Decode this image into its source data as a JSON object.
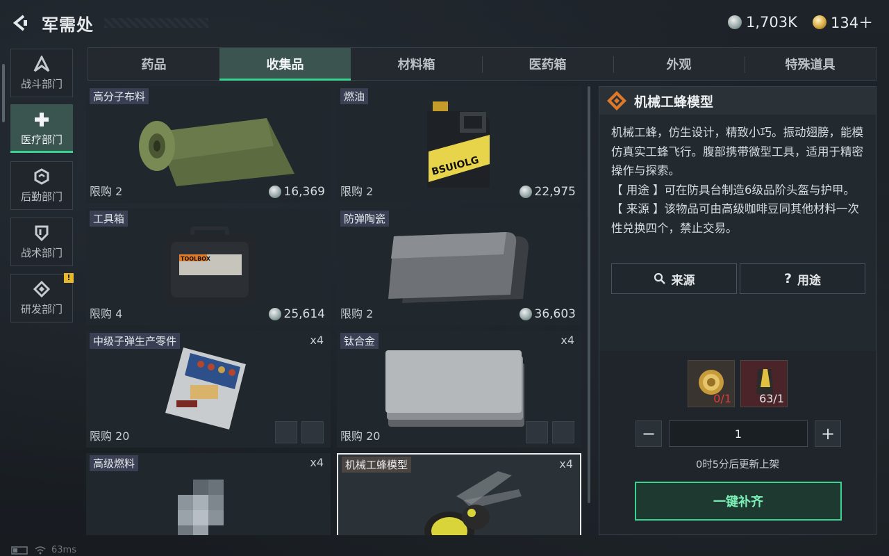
{
  "header": {
    "title": "军需处",
    "currency": [
      {
        "icon": "silver-coin-icon",
        "value": "1,703K"
      },
      {
        "icon": "gold-coin-icon",
        "value": "134＋"
      }
    ]
  },
  "sidebar": {
    "items": [
      {
        "label": "战斗部门",
        "icon": "combat-icon"
      },
      {
        "label": "医疗部门",
        "icon": "medical-cross-icon",
        "active": true
      },
      {
        "label": "后勤部门",
        "icon": "logistics-icon"
      },
      {
        "label": "战术部门",
        "icon": "tactical-shield-icon"
      },
      {
        "label": "研发部门",
        "icon": "research-icon",
        "badge": "!"
      }
    ]
  },
  "tabs": [
    "药品",
    "收集品",
    "材料箱",
    "医药箱",
    "外观",
    "特殊道具"
  ],
  "active_tab": "收集品",
  "items": [
    {
      "name": "高分子布料",
      "limit": "限购 2",
      "price": "16,369",
      "qty": ""
    },
    {
      "name": "燃油",
      "limit": "限购 2",
      "price": "22,975",
      "qty": "",
      "label_art": "BSUIOLG"
    },
    {
      "name": "工具箱",
      "limit": "限购 4",
      "price": "25,614",
      "qty": "",
      "label_art": "TOOLBOX"
    },
    {
      "name": "防弹陶瓷",
      "limit": "限购 2",
      "price": "36,603",
      "qty": ""
    },
    {
      "name": "中级子弹生产零件",
      "limit": "限购 20",
      "price": "",
      "qty": "x4"
    },
    {
      "name": "钛合金",
      "limit": "限购 20",
      "price": "",
      "qty": "x4"
    },
    {
      "name": "高级燃料",
      "limit": "",
      "price": "",
      "qty": "x4"
    },
    {
      "name": "机械工蜂模型",
      "limit": "",
      "price": "",
      "qty": "x4",
      "selected": true
    }
  ],
  "detail": {
    "title": "机械工蜂模型",
    "description": "机械工蜂，仿生设计，精致小巧。振动翅膀，能模仿真实工蜂飞行。腹部携带微型工具，适用于精密操作与探索。",
    "usage": "【 用途 】可在防具台制造6级品阶头盔与护甲。",
    "source": "【 来源 】该物品可由高级咖啡豆同其他材料一次性兑换四个，禁止交易。",
    "buttons": {
      "source": "来源",
      "usage": "用途"
    },
    "materials": [
      {
        "count": "0/1",
        "color": "#e03a3a"
      },
      {
        "count": "63/1",
        "color": "#e8eaeb"
      }
    ],
    "quantity": "1",
    "restock_text": "0时5分后更新上架",
    "fill_button": "一键补齐"
  },
  "status": {
    "ping": "63ms"
  }
}
